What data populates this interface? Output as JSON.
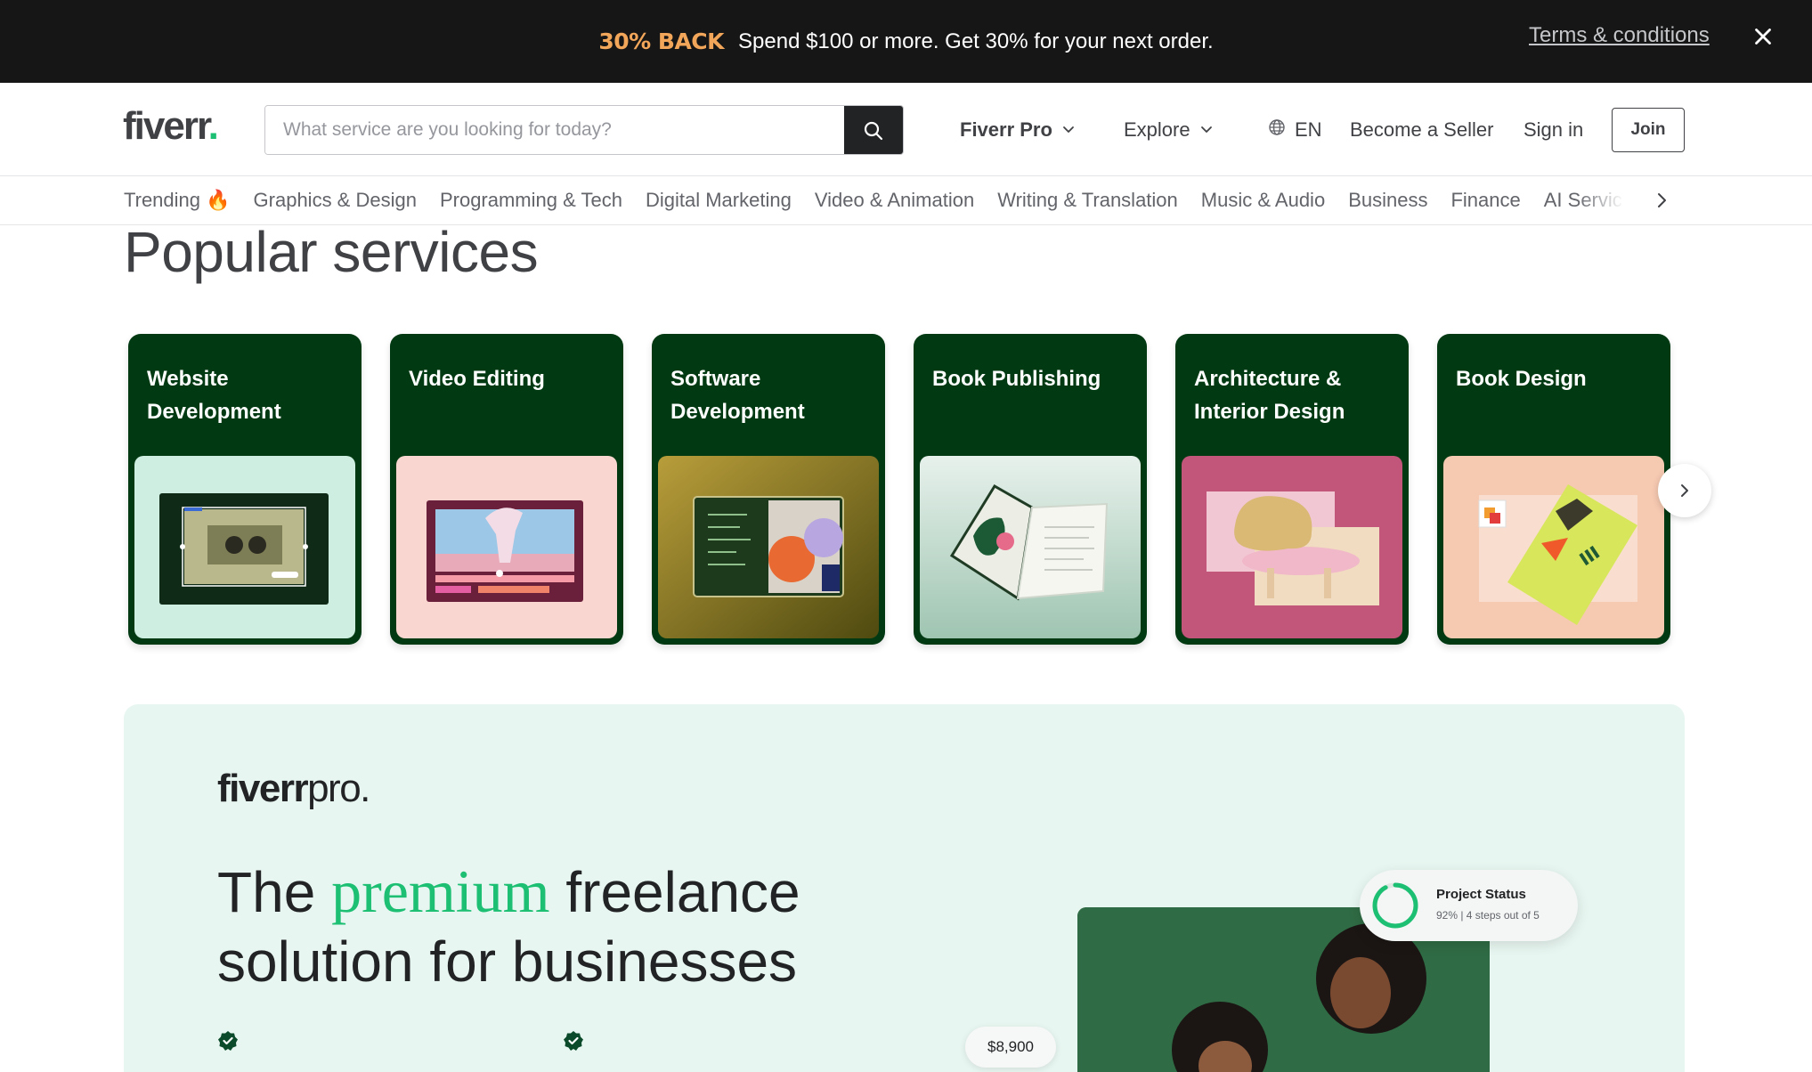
{
  "promo": {
    "badge": "30% BACK",
    "text": "Spend $100 or more. Get 30% for your next order.",
    "terms": "Terms & conditions"
  },
  "header": {
    "logo": "fiverr",
    "logo_dot": ".",
    "search_placeholder": "What service are you looking for today?",
    "nav": {
      "fiverr_pro": "Fiverr Pro",
      "explore": "Explore",
      "language": "EN",
      "become_seller": "Become a Seller",
      "sign_in": "Sign in",
      "join": "Join"
    }
  },
  "categories": [
    "Trending 🔥",
    "Graphics & Design",
    "Programming & Tech",
    "Digital Marketing",
    "Video & Animation",
    "Writing & Translation",
    "Music & Audio",
    "Business",
    "Finance",
    "AI Servic"
  ],
  "popular": {
    "title": "Popular services",
    "cards": [
      {
        "title": "Website Development",
        "img_bg": "#cdeee0"
      },
      {
        "title": "Video Editing",
        "img_bg": "#f9d6cf"
      },
      {
        "title": "Software Development",
        "img_bg": "#8b7a16"
      },
      {
        "title": "Book Publishing",
        "img_bg": "#b9d8c8"
      },
      {
        "title": "Architecture & Interior Design",
        "img_bg": "#c2557a"
      },
      {
        "title": "Book Design",
        "img_bg": "#f6c9b1"
      }
    ]
  },
  "pro": {
    "logo_bold": "fiverr",
    "logo_light": "pro.",
    "headline_pre": "The ",
    "headline_accent": "premium",
    "headline_post": " freelance solution for businesses",
    "status_title": "Project Status",
    "status_sub": "92% | 4 steps out of 5",
    "status_progress": 0.92,
    "price": "$8,900"
  },
  "colors": {
    "brand_green": "#1dbf73",
    "card_green": "#003912",
    "pro_bg": "#e8f6f1"
  }
}
